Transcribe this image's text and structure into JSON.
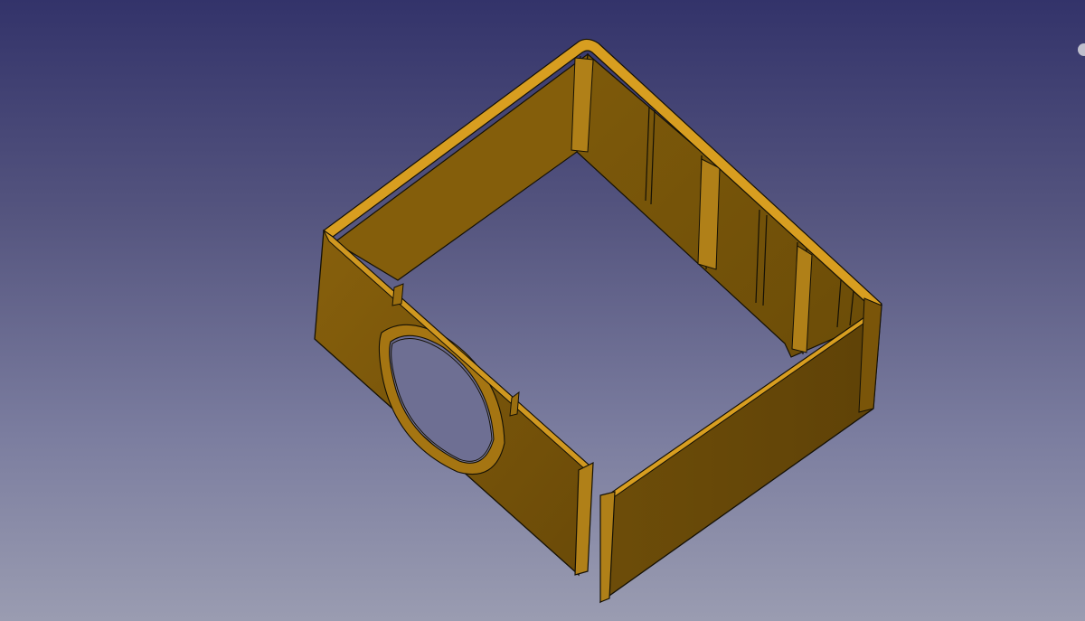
{
  "viewer": {
    "object_name": "enclosure-frame",
    "body_color": "#7a5509",
    "rim_color": "#d89e20",
    "edge_color": "#141005",
    "background_top": "#33336a",
    "background_bottom": "#9a9cb1"
  },
  "icons": {
    "navigation-cube": "circle-glyph"
  }
}
